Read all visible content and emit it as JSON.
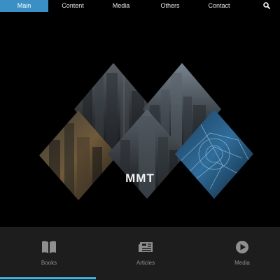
{
  "nav": {
    "items": [
      "Main",
      "Content",
      "Media",
      "Others",
      "Contact"
    ],
    "active_index": 0,
    "search_icon": "search-icon"
  },
  "hero": {
    "logo_text": "MMT",
    "tiles": [
      "skyscraper-photo",
      "city-skyline-photo",
      "sunset-tower-photo",
      "tower-photo",
      "circuit-photo"
    ]
  },
  "bottom": {
    "tabs": [
      {
        "label": "Books",
        "icon": "book-icon"
      },
      {
        "label": "Articles",
        "icon": "newspaper-icon"
      },
      {
        "label": "Media",
        "icon": "play-icon"
      }
    ]
  },
  "colors": {
    "accent": "#3a8fc4",
    "indicator": "#3fb4e2",
    "background": "#000000",
    "bottom_bar": "#1d1d1d"
  }
}
